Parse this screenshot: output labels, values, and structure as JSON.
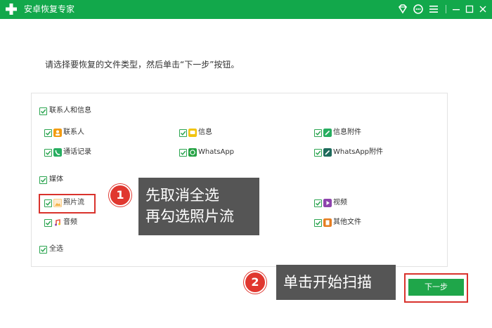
{
  "window": {
    "title": "安卓恢复专家"
  },
  "instruction": "请选择要恢复的文件类型，然后单击“下一步”按钮。",
  "groups": {
    "contacts": {
      "label": "联系人和信息",
      "items": [
        {
          "label": "联系人",
          "icon": "contact-icon",
          "color": "#f39c12"
        },
        {
          "label": "信息",
          "icon": "message-icon",
          "color": "#f1c40f"
        },
        {
          "label": "信息附件",
          "icon": "attachment-icon",
          "color": "#27ae60"
        },
        {
          "label": "通话记录",
          "icon": "phone-icon",
          "color": "#27ae60"
        },
        {
          "label": "WhatsApp",
          "icon": "whatsapp-icon",
          "color": "#25a244"
        },
        {
          "label": "WhatsApp附件",
          "icon": "whatsapp-attachment-icon",
          "color": "#1e6b5c"
        }
      ]
    },
    "media": {
      "label": "媒体",
      "items": [
        {
          "label": "照片流",
          "icon": "photo-icon",
          "color": "#f5b041"
        },
        {
          "label": "视频",
          "icon": "video-icon",
          "color": "#8e44ad"
        },
        {
          "label": "音频",
          "icon": "audio-icon",
          "color": "#e74c3c"
        },
        {
          "label": "其他文件",
          "icon": "file-icon",
          "color": "#e67e22"
        }
      ]
    }
  },
  "select_all": "全选",
  "callouts": [
    {
      "number": "1",
      "line1": "先取消全选",
      "line2": "再勾选照片流"
    },
    {
      "number": "2",
      "text": "单击开始扫描"
    }
  ],
  "next_button": "下一步",
  "colors": {
    "titlebar": "#12a84b",
    "accent": "#1fa64a",
    "highlight": "#d9322c"
  }
}
